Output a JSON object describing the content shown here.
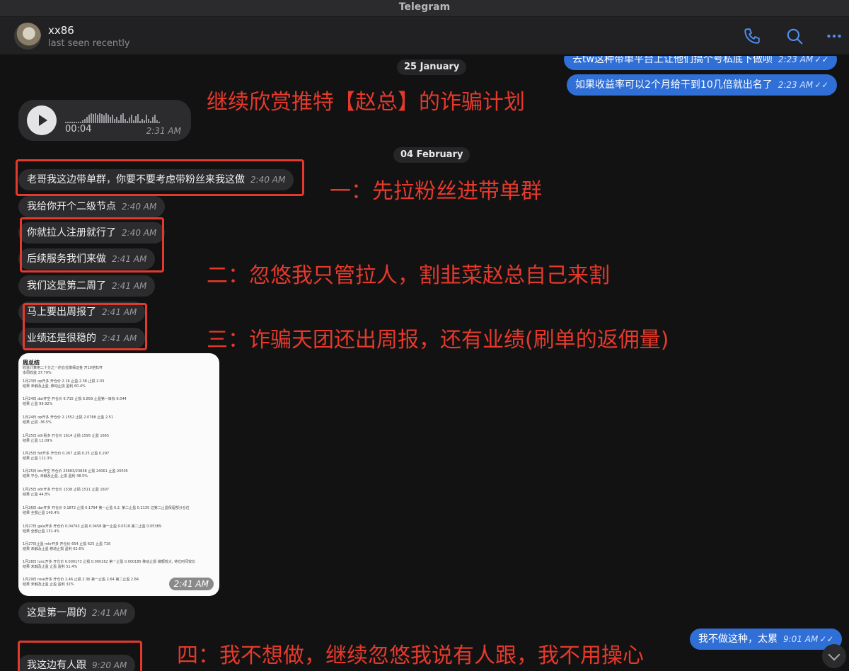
{
  "window": {
    "title": "Telegram"
  },
  "header": {
    "name": "xx86",
    "status": "last seen recently"
  },
  "dates": [
    "25 January",
    "04 February"
  ],
  "outgoing": [
    {
      "text": "去tw这种带单平台上让他们搞个号私底下做呗",
      "time": "2:23 AM",
      "ticks": "✓✓"
    },
    {
      "text": "如果收益率可以2个月给干到10几倍就出名了",
      "time": "2:23 AM",
      "ticks": "✓✓"
    },
    {
      "text": "我不做这种，太累",
      "time": "9:01 AM",
      "ticks": "✓✓"
    }
  ],
  "voice": {
    "duration": "00:04",
    "time": "2:31 AM"
  },
  "incoming": [
    {
      "text": "老哥我这边带单群，你要不要考虑带粉丝来我这做",
      "time": "2:40 AM"
    },
    {
      "text": "我给你开个二级节点",
      "time": "2:40 AM"
    },
    {
      "text": "你就拉人注册就行了",
      "time": "2:40 AM"
    },
    {
      "text": "后续服务我们来做",
      "time": "2:41 AM"
    },
    {
      "text": "我们这是第二周了",
      "time": "2:41 AM"
    },
    {
      "text": "马上要出周报了",
      "time": "2:41 AM"
    },
    {
      "text": "业绩还是很稳的",
      "time": "2:41 AM"
    },
    {
      "text": "这是第一周的",
      "time": "2:41 AM"
    },
    {
      "text": "我这边有人跟",
      "time": "9:20 AM"
    }
  ],
  "image_message": {
    "time": "2:41 AM",
    "title": "周总结",
    "lines": [
      "收益计算用二十分之一的仓位做保证金 开10倍杠杆",
      "本周收益 37.79%",
      "1月23日 op开多 开仓价 2.16 止盈 2.38 止损 2.03",
      "结果 未触及止盈, 移动止损 盈利 60.4%",
      "1月24日 dot开空 开仓价 6.715 止损 6.859 止盈第一目标 6.044",
      "结果 止盈 99.92%",
      "1月24日 op开多 开仓价 2.1552 止损 2.0768 止盈 2.51",
      "结果 止损 -36.5%",
      "1月25日 eth看多 开仓价 1614 止损 1595 止盈 1665",
      "结果 止盈 12.09%",
      "1月25日 fet开多 开仓价 0.267 止损 0.25 止盈 0.297",
      "结果 止盈 112.3%",
      "1月25日 btc开空 开仓价 23683/23838 止损 24061 止盈 20505",
      "结果 平仓, 未触及止盈, 止损 盈利 48.5%",
      "1月25日 eth开多 开仓价 1538 止损 1511 止盈 1607",
      "结果 止盈 44.8%",
      "1月26日 dar开多 开仓价 0.1872 止损 0.1794 第一止盈 0.2, 第二止盈 0.2135 过第二止盈保留部分仓位",
      "结果 全部止盈 140.4%",
      "1月27日 gala开多 开仓价 0.04763 止损 0.0458 第一止盈 0.0518 第二止盈 0.05389",
      "结果 全部止盈 131.4%",
      "1月27日止盈 mkr开多 开仓价 654 止损 625 止盈 716",
      "结果 未触及止盈 移动止损 盈利 62.6%",
      "1月28日 lunc开多 开仓价 0.000173 止损 0.000162 第一止盈 0.000185 移动止损 做额较大, 待仓时间较长",
      "结果 未触及止盈 止盈 盈利 51.4%",
      "1月29日 rose开多 开仓价 2.46 止损 2.36 第一止盈 2.64 第二止盈 2.84",
      "结果 未触及止盈 止盈 盈利 32%"
    ]
  },
  "annotations": {
    "title": "继续欣赏推特【赵总】的诈骗计划",
    "one": "一：先拉粉丝进带单群",
    "two": "二：忽悠我只管拉人，割韭菜赵总自己来割",
    "three": "三：诈骗天团还出周报，还有业绩(刷单的返佣量)",
    "four": "四：我不想做，继续忽悠我说有人跟，我不用操心"
  },
  "colors": {
    "accent": "#2f6fd6",
    "annotation": "#e6392b",
    "background": "#121213"
  },
  "icons": [
    "phone-icon",
    "search-icon",
    "more-icon",
    "play-icon",
    "chevron-down-icon"
  ]
}
